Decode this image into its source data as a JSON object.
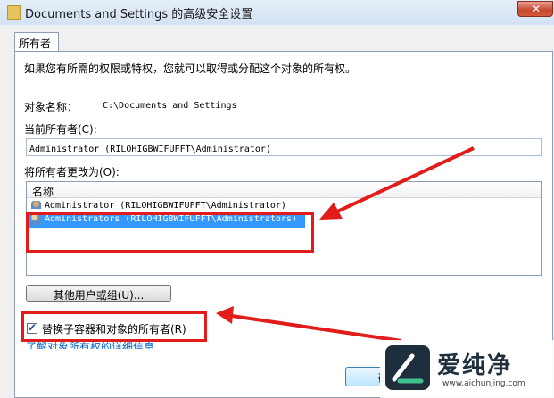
{
  "window": {
    "title": "Documents and Settings 的高级安全设置",
    "close_label": "✕"
  },
  "tabs": [
    {
      "label": "所有者"
    }
  ],
  "intro": "如果您有所需的权限或特权，您就可以取得或分配这个对象的所有权。",
  "object_name_label": "对象名称：",
  "object_name_value": "C:\\Documents and Settings",
  "current_owner_label": "当前所有者(C):",
  "current_owner_value": "Administrator (RILOHIGBWIFUFFT\\Administrator)",
  "change_owner_label": "将所有者更改为(O):",
  "list": {
    "header": "名称",
    "items": [
      {
        "label": "Administrator (RILOHIGBWIFUFFT\\Administrator)",
        "icon": "user-icon",
        "selected": false
      },
      {
        "label": "Administrators (RILOHIGBWIFUFFT\\Administrators)",
        "icon": "group-icon",
        "selected": true
      }
    ]
  },
  "other_users_button": "其他用户或组(U)...",
  "replace_checkbox": {
    "label": "替换子容器和对象的所有者(R)",
    "checked": true
  },
  "learn_more_link": "了解对象所有权的详细信息",
  "ok_button": "确",
  "watermark": {
    "brand": "爱纯净",
    "url": "www.aichunjing.com"
  },
  "colors": {
    "annotation": "#e21b1b",
    "selection": "#3399ff",
    "link": "#0066cc"
  }
}
